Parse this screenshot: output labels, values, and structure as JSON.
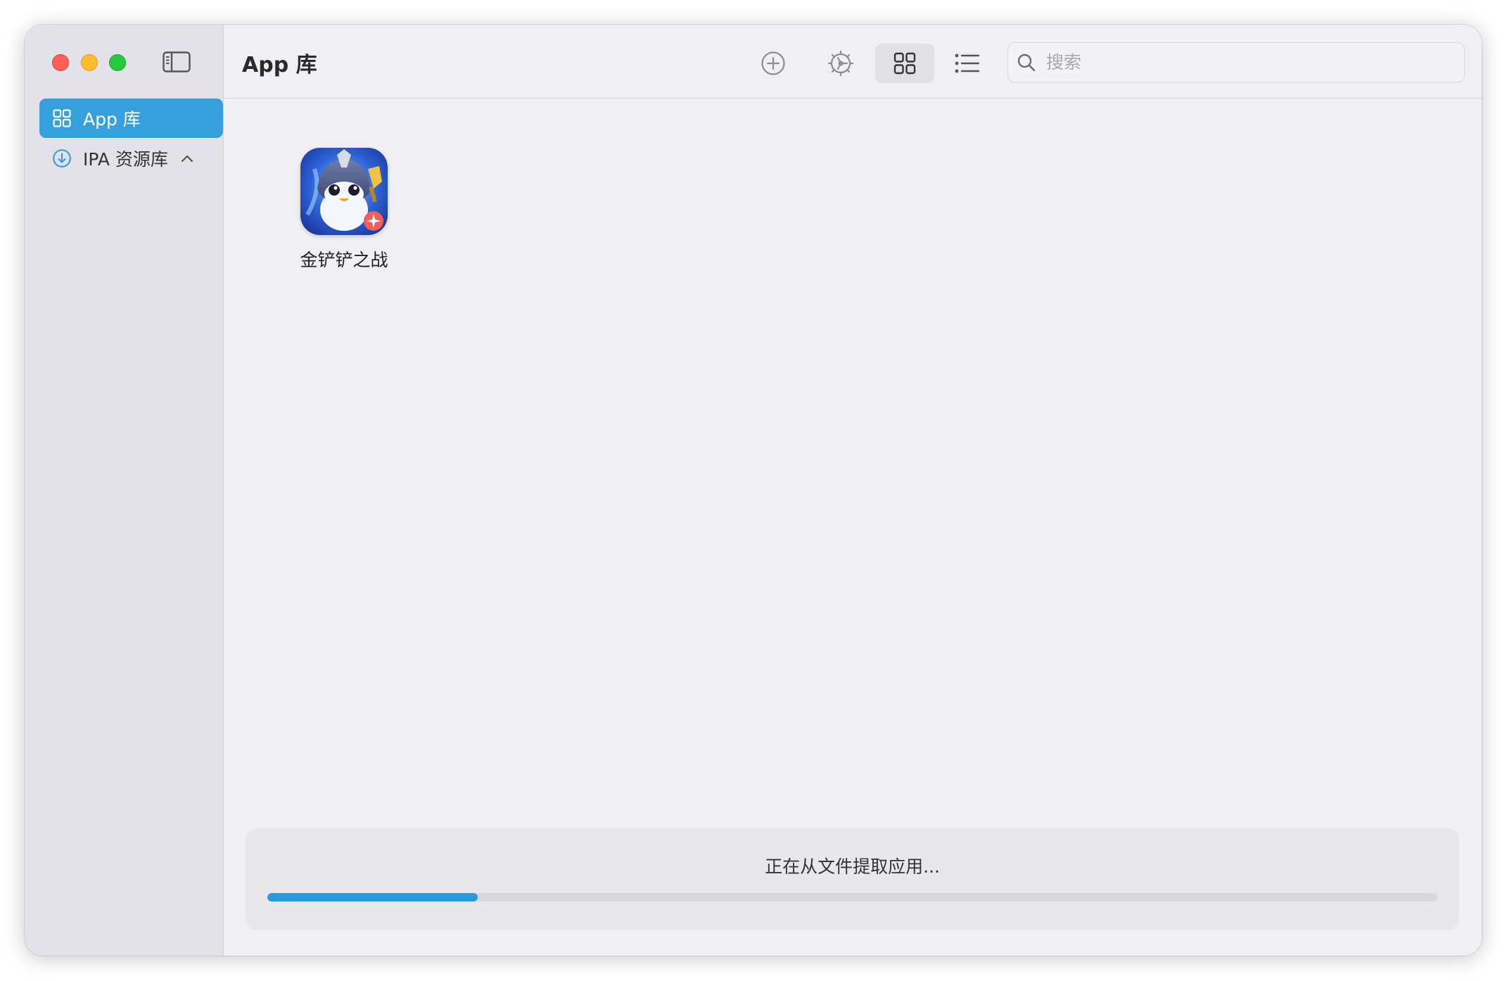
{
  "sidebar": {
    "items": [
      {
        "label": "App 库",
        "icon": "grid-icon",
        "selected": true
      },
      {
        "label": "IPA 资源库",
        "icon": "download-circle-icon",
        "expanded": true
      }
    ]
  },
  "toolbar": {
    "title": "App 库",
    "search_placeholder": "搜索",
    "search_value": "",
    "view_mode": "grid"
  },
  "apps": [
    {
      "name": "金铲铲之战",
      "icon": "penguin-game-icon"
    }
  ],
  "progress": {
    "label": "正在从文件提取应用...",
    "fraction": 0.18
  },
  "colors": {
    "accent": "#36a0dc",
    "progress_fill": "#2c99dc",
    "close": "#fe5f57",
    "minimize": "#febc2e",
    "zoom": "#28c840"
  }
}
